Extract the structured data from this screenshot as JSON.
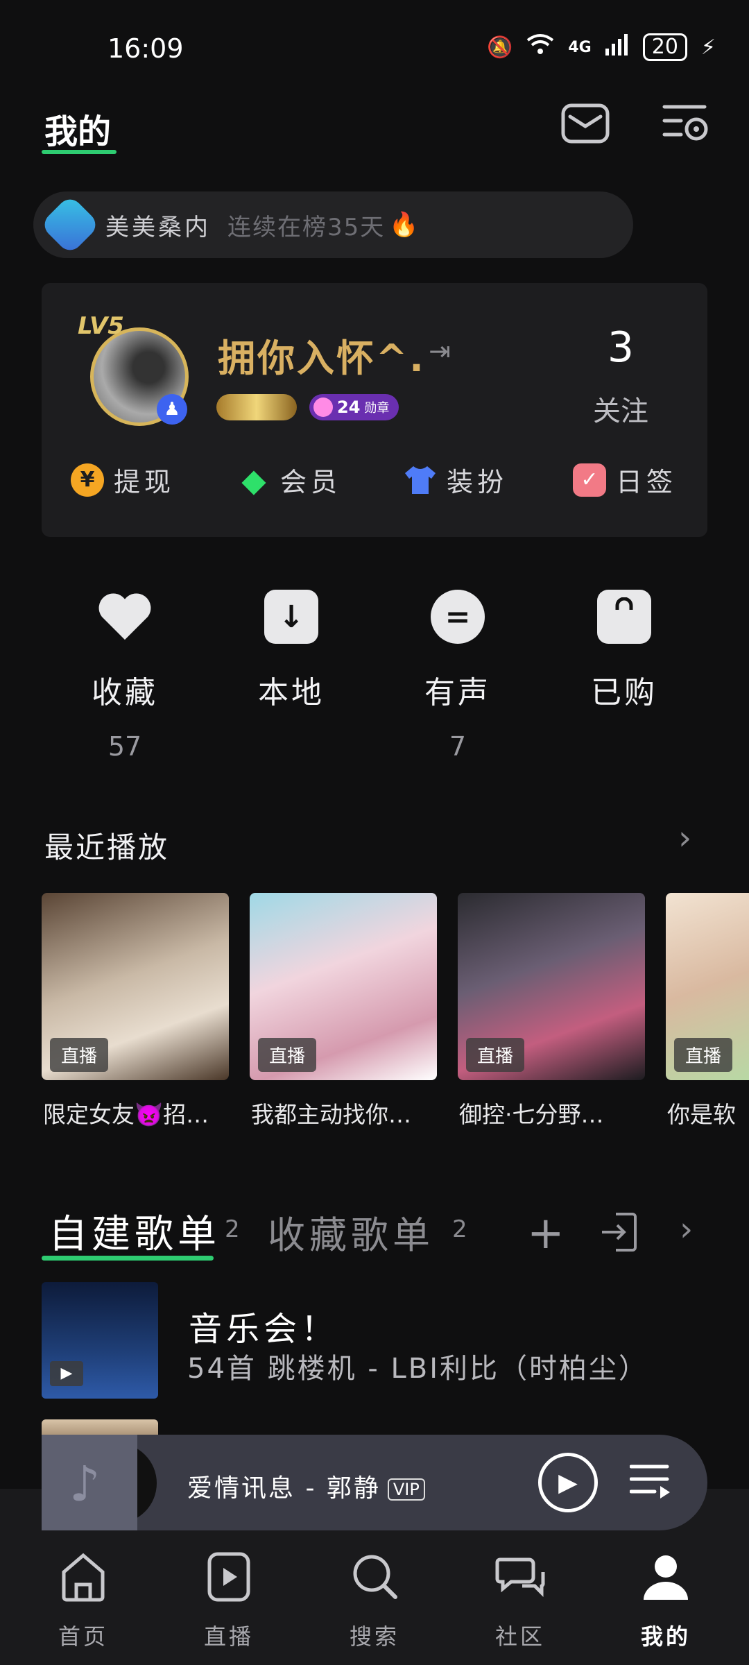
{
  "status_bar": {
    "time": "16:09",
    "battery": "20",
    "network": "4G"
  },
  "header": {
    "title": "我的"
  },
  "banner": {
    "name": "美美桑内",
    "rank_text": "连续在榜35天"
  },
  "profile": {
    "username": "拥你入怀^.",
    "level": "LV5",
    "medal_count": "24",
    "medal_label": "勋章",
    "follow_count": "3",
    "follow_label": "关注",
    "quick_actions": [
      {
        "label": "提现",
        "icon": "yen-coin-icon",
        "glyph": "¥",
        "color": "#f5a623"
      },
      {
        "label": "会员",
        "icon": "diamond-icon",
        "glyph": "◆",
        "color": "#2ee06a"
      },
      {
        "label": "装扮",
        "icon": "tshirt-icon",
        "glyph": "👕",
        "color": "#4f7cf7"
      },
      {
        "label": "日签",
        "icon": "checkmark-icon",
        "glyph": "✓",
        "color": "#f27a86"
      }
    ]
  },
  "library": [
    {
      "label": "收藏",
      "count": "57",
      "icon": "heart-icon"
    },
    {
      "label": "本地",
      "count": "",
      "icon": "download-icon"
    },
    {
      "label": "有声",
      "count": "7",
      "icon": "audiobook-icon"
    },
    {
      "label": "已购",
      "count": "",
      "icon": "shopping-bag-icon"
    }
  ],
  "recent": {
    "title": "最近播放",
    "items": [
      {
        "tag": "直播",
        "caption": "限定女友👿招…"
      },
      {
        "tag": "直播",
        "caption": "我都主动找你…"
      },
      {
        "tag": "直播",
        "caption": "御控·七分野…"
      },
      {
        "tag": "直播",
        "caption": "你是软"
      }
    ]
  },
  "playlists": {
    "tabs": [
      {
        "label": "自建歌单",
        "count": "2"
      },
      {
        "label": "收藏歌单",
        "count": "2"
      }
    ],
    "items": [
      {
        "title": "音乐会！",
        "subtitle": "54首 跳楼机 - LBI利比（时柏尘）"
      }
    ]
  },
  "player": {
    "title": "爱情讯息 - 郭静",
    "badge": "VIP"
  },
  "bottom_nav": [
    {
      "label": "首页",
      "icon": "home-icon"
    },
    {
      "label": "直播",
      "icon": "live-play-icon"
    },
    {
      "label": "搜索",
      "icon": "search-icon"
    },
    {
      "label": "社区",
      "icon": "community-chat-icon"
    },
    {
      "label": "我的",
      "icon": "profile-icon",
      "active": true
    }
  ]
}
